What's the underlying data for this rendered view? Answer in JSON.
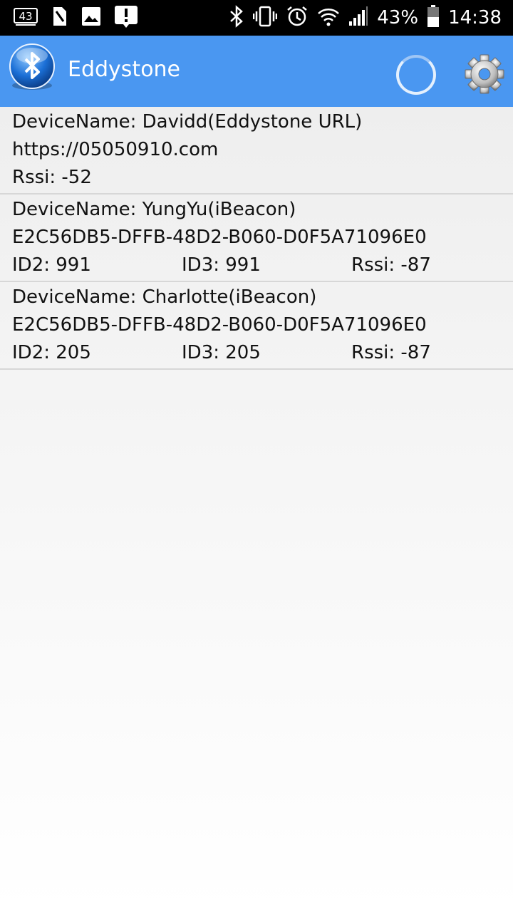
{
  "status_bar": {
    "notification_badge": "43",
    "battery_percent": "43%",
    "time": "14:38",
    "icons": [
      "notification-43-icon",
      "sim-icon",
      "image-icon",
      "alert-icon",
      "bluetooth-icon",
      "vibrate-icon",
      "alarm-icon",
      "wifi-icon",
      "signal-icon",
      "battery-icon"
    ]
  },
  "app_bar": {
    "title": "Eddystone",
    "colors": {
      "bar": "#4a97f1"
    }
  },
  "devices": [
    {
      "name": "DeviceName: Davidd(Eddystone URL)",
      "line2": "https://05050910.com",
      "rssi": "Rssi: -52"
    },
    {
      "name": "DeviceName: YungYu(iBeacon)",
      "line2": "E2C56DB5-DFFB-48D2-B060-D0F5A71096E0",
      "id2": "ID2: 991",
      "id3": "ID3: 991",
      "rssi": "Rssi: -87"
    },
    {
      "name": "DeviceName: Charlotte(iBeacon)",
      "line2": "E2C56DB5-DFFB-48D2-B060-D0F5A71096E0",
      "id2": "ID2: 205",
      "id3": "ID3: 205",
      "rssi": "Rssi: -87"
    }
  ]
}
